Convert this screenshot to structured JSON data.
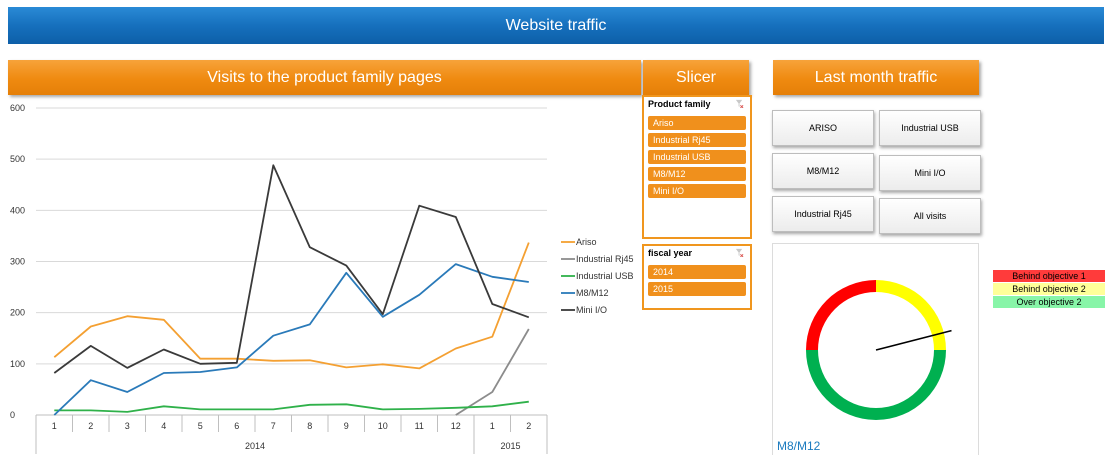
{
  "dashboard": {
    "title": "Website traffic"
  },
  "sections": {
    "visits": "Visits to the product family pages",
    "slicer": "Slicer",
    "last_month": "Last month traffic"
  },
  "chart_data": {
    "type": "line",
    "x": [
      "1",
      "2",
      "3",
      "4",
      "5",
      "6",
      "7",
      "8",
      "9",
      "10",
      "11",
      "12",
      "1",
      "2"
    ],
    "x_groups": [
      {
        "label": "2014",
        "count": 12
      },
      {
        "label": "2015",
        "count": 2
      }
    ],
    "ylim": [
      0,
      600
    ],
    "yticks": [
      0,
      100,
      200,
      300,
      400,
      500,
      600
    ],
    "grid": true,
    "legend": "right",
    "series": [
      {
        "name": "Ariso",
        "color": "#f4a032",
        "values": [
          113,
          173,
          193,
          186,
          110,
          110,
          106,
          107,
          93,
          99,
          91,
          130,
          153,
          337
        ]
      },
      {
        "name": "Industrial Rj45",
        "color": "#8c8c8c",
        "values": [
          null,
          null,
          null,
          null,
          null,
          null,
          null,
          null,
          null,
          null,
          null,
          0,
          45,
          168
        ]
      },
      {
        "name": "Industrial USB",
        "color": "#2fb14a",
        "values": [
          9,
          9,
          6,
          17,
          11,
          11,
          11,
          20,
          21,
          11,
          12,
          14,
          17,
          26
        ]
      },
      {
        "name": "M8/M12",
        "color": "#2a7ab9",
        "values": [
          0,
          68,
          45,
          82,
          84,
          93,
          155,
          177,
          278,
          192,
          235,
          295,
          270,
          260
        ]
      },
      {
        "name": "Mini I/O",
        "color": "#3a3a3a",
        "values": [
          82,
          135,
          92,
          128,
          100,
          102,
          488,
          328,
          292,
          197,
          409,
          387,
          217,
          191
        ]
      }
    ]
  },
  "slicers": {
    "product_family": {
      "label": "Product family",
      "items": [
        "Ariso",
        "Industrial Rj45",
        "Industrial USB",
        "M8/M12",
        "Mini I/O"
      ]
    },
    "fiscal_year": {
      "label": "fiscal year",
      "items": [
        "2014",
        "2015"
      ]
    }
  },
  "buttons": {
    "ariso": "ARISO",
    "industrial_usb": "Industrial USB",
    "m8m12": "M8/M12",
    "mini_io": "Mini I/O",
    "industrial_rj45": "Industrial Rj45",
    "all_visits": "All visits"
  },
  "gauge": {
    "label": "M8/M12",
    "needle_value": 0.21,
    "colors": {
      "red": "#ff0000",
      "yellow": "#ffff00",
      "green": "#00b050"
    }
  },
  "objective_legend": [
    {
      "label": "Behind objective 1",
      "color": "#ff3b3b"
    },
    {
      "label": "Behind objective 2",
      "color": "#ffff99"
    },
    {
      "label": "Over objective 2",
      "color": "#88f5a8"
    }
  ]
}
